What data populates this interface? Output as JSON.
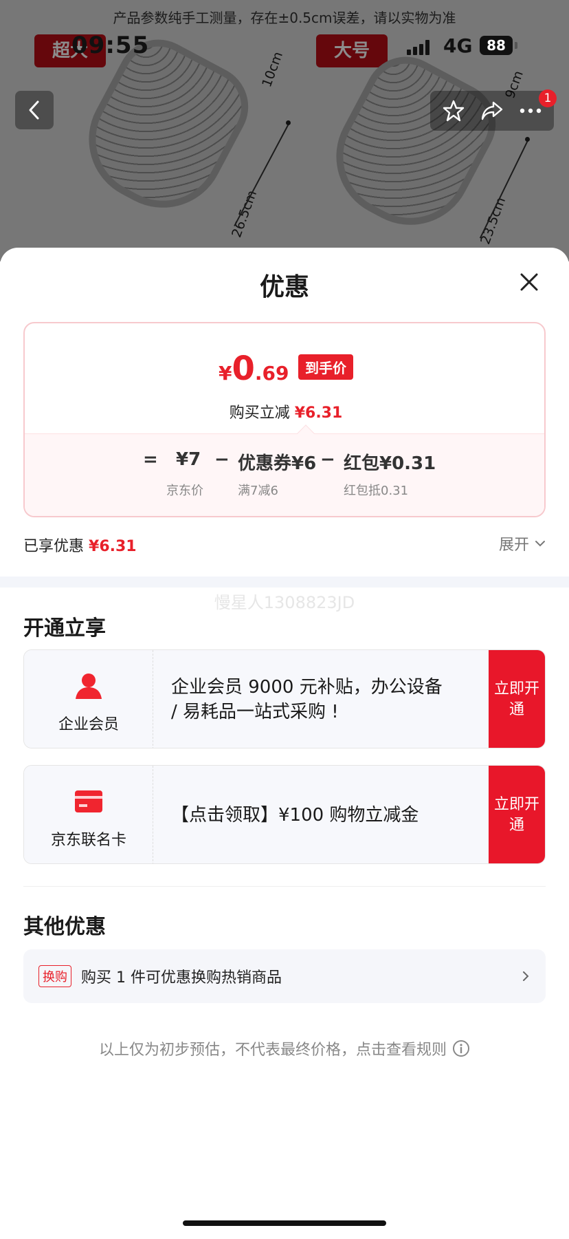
{
  "background": {
    "caption": "产品参数纯手工测量，存在±0.5cm误差，请以实物为准",
    "left_tag": "超大",
    "right_tag": "大号",
    "dims": [
      "10cm",
      "26.5cm",
      "9cm",
      "23.5cm"
    ]
  },
  "status_bar": {
    "time": "09:55",
    "network": "4G",
    "battery": "88"
  },
  "nav": {
    "badge_count": "1"
  },
  "sheet": {
    "title": "优惠",
    "price": {
      "yen": "¥",
      "integer": "0",
      "decimal": ".69",
      "tag": "到手价",
      "sub_label": "购买立减",
      "sub_amount": "¥6.31"
    },
    "formula": {
      "equals": "=",
      "base": "¥7",
      "base_label": "京东价",
      "minus1": "−",
      "coupon": "优惠券¥6",
      "coupon_label": "满7减6",
      "minus2": "−",
      "redpacket": "红包¥0.31",
      "redpacket_label": "红包抵0.31"
    },
    "enjoyed_label": "已享优惠",
    "enjoyed_amount": "¥6.31",
    "expand_label": "展开",
    "watermark": "慢星人1308823JD",
    "open_section_title": "开通立享",
    "cards": [
      {
        "name": "企业会员",
        "desc": "企业会员 9000 元补贴，办公设备 / 易耗品一站式采购 !",
        "button": "立即开通",
        "icon": "person-icon"
      },
      {
        "name": "京东联名卡",
        "desc": "【点击领取】¥100 购物立减金",
        "button": "立即开通",
        "icon": "card-icon"
      }
    ],
    "other_section_title": "其他优惠",
    "other": {
      "tag": "换购",
      "text": "购买 1 件可优惠换购热销商品"
    },
    "disclaimer": "以上仅为初步预估，不代表最终价格，点击查看规则"
  },
  "colors": {
    "accent": "#e8202a",
    "button": "#e8172a",
    "card_border": "#f7c9cd"
  }
}
